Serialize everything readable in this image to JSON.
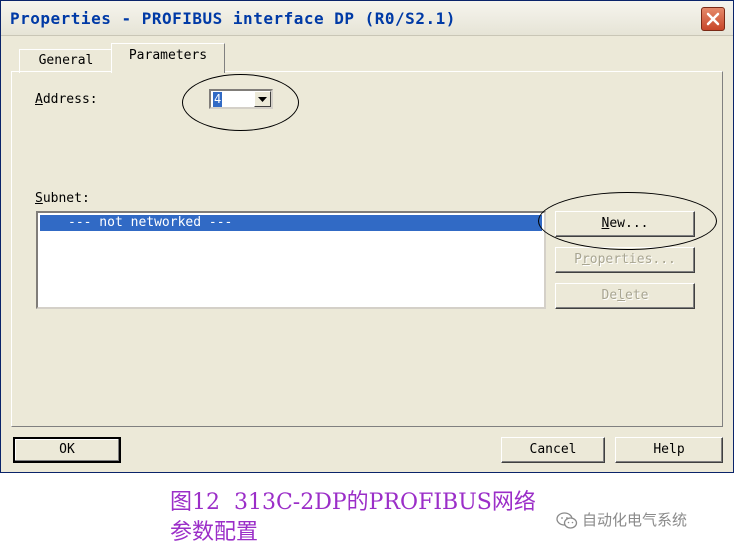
{
  "window": {
    "title": "Properties - PROFIBUS interface  DP (R0/S2.1)"
  },
  "tabs": [
    {
      "label": "General",
      "active": false
    },
    {
      "label": "Parameters",
      "active": true
    }
  ],
  "address": {
    "label_accel": "A",
    "label_rest": "ddress:",
    "value": "4"
  },
  "subnet": {
    "label_accel": "S",
    "label_rest": "ubnet:",
    "items": [
      "--- not networked ---"
    ]
  },
  "side_buttons": {
    "new": {
      "accel": "N",
      "rest": "ew..."
    },
    "properties": {
      "pre": "P",
      "accel": "r",
      "rest": "operties..."
    },
    "delete": {
      "pre": "De",
      "accel": "l",
      "rest": "ete"
    }
  },
  "footer": {
    "ok": "OK",
    "cancel": "Cancel",
    "help": "Help"
  },
  "caption": {
    "line1": "图12  313C-2DP的PROFIBUS网络",
    "line2": "参数配置"
  },
  "watermark": {
    "text": "自动化电气系统",
    "icon": "wechat-icon"
  },
  "colors": {
    "title_text": "#003aa6",
    "selection": "#316ac5",
    "caption": "#9b2ec8",
    "close_button": "#c8462a"
  }
}
